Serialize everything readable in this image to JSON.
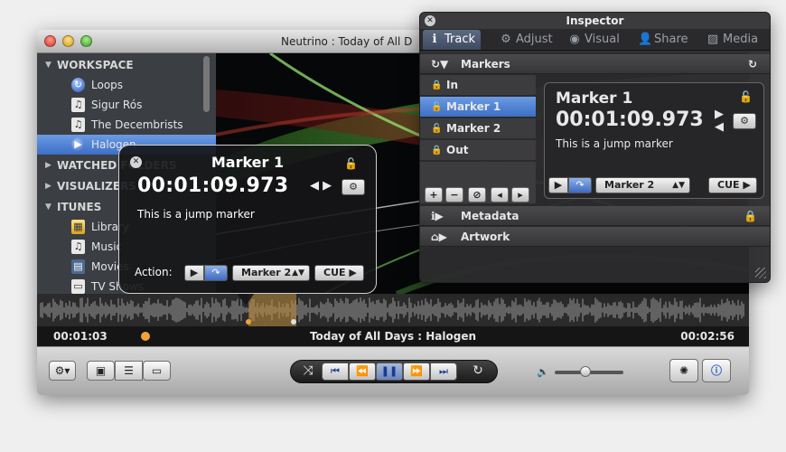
{
  "window": {
    "title": "Neutrino : Today of All D"
  },
  "sidebar": {
    "sections": [
      {
        "label": "WORKSPACE",
        "expanded": true
      },
      {
        "label": "WATCHED FOLDERS",
        "expanded": false
      },
      {
        "label": "VISUALIZERS",
        "expanded": false
      },
      {
        "label": "ITUNES",
        "expanded": true
      }
    ],
    "workspace_items": [
      {
        "label": "Loops",
        "icon": "loop-icon"
      },
      {
        "label": "Sigur Rós",
        "icon": "music-note-icon"
      },
      {
        "label": "The Decembrists",
        "icon": "music-note-icon"
      },
      {
        "label": "Halogen",
        "icon": "play-circle-icon",
        "selected": true
      }
    ],
    "itunes_items": [
      {
        "label": "Library",
        "icon": "library-icon"
      },
      {
        "label": "Music",
        "icon": "music-note-icon"
      },
      {
        "label": "Movies",
        "icon": "film-icon"
      },
      {
        "label": "TV Shows",
        "icon": "tv-icon"
      }
    ]
  },
  "hud": {
    "title": "Marker 1",
    "time": "00:01:09.973",
    "description": "This is a jump marker",
    "action_label": "Action:",
    "target_marker": "Marker 2",
    "cue_label": "CUE"
  },
  "status_bar": {
    "elapsed": "00:01:03",
    "now_playing": "Today of All Days : Halogen",
    "duration": "00:02:56"
  },
  "volume": {
    "level": 0.45
  },
  "inspector": {
    "title": "Inspector",
    "tabs": [
      {
        "label": "Track",
        "icon": "info-icon",
        "active": true
      },
      {
        "label": "Adjust",
        "icon": "gear-icon"
      },
      {
        "label": "Visual",
        "icon": "eye-icon"
      },
      {
        "label": "Share",
        "icon": "person-icon"
      },
      {
        "label": "Media",
        "icon": "media-icon"
      }
    ],
    "sections": {
      "markers": "Markers",
      "metadata": "Metadata",
      "artwork": "Artwork"
    },
    "marker_list": [
      {
        "label": "In",
        "selected": false
      },
      {
        "label": "Marker 1",
        "selected": true
      },
      {
        "label": "Marker 2",
        "selected": false
      },
      {
        "label": "Out",
        "selected": false
      }
    ],
    "detail": {
      "name": "Marker 1",
      "time": "00:01:09.973",
      "description": "This is a jump marker",
      "target_marker": "Marker 2",
      "cue_label": "CUE"
    }
  },
  "colors": {
    "accent": "#3c6fc5",
    "marker": "#f2a23a",
    "selection": "#6b9be4"
  }
}
